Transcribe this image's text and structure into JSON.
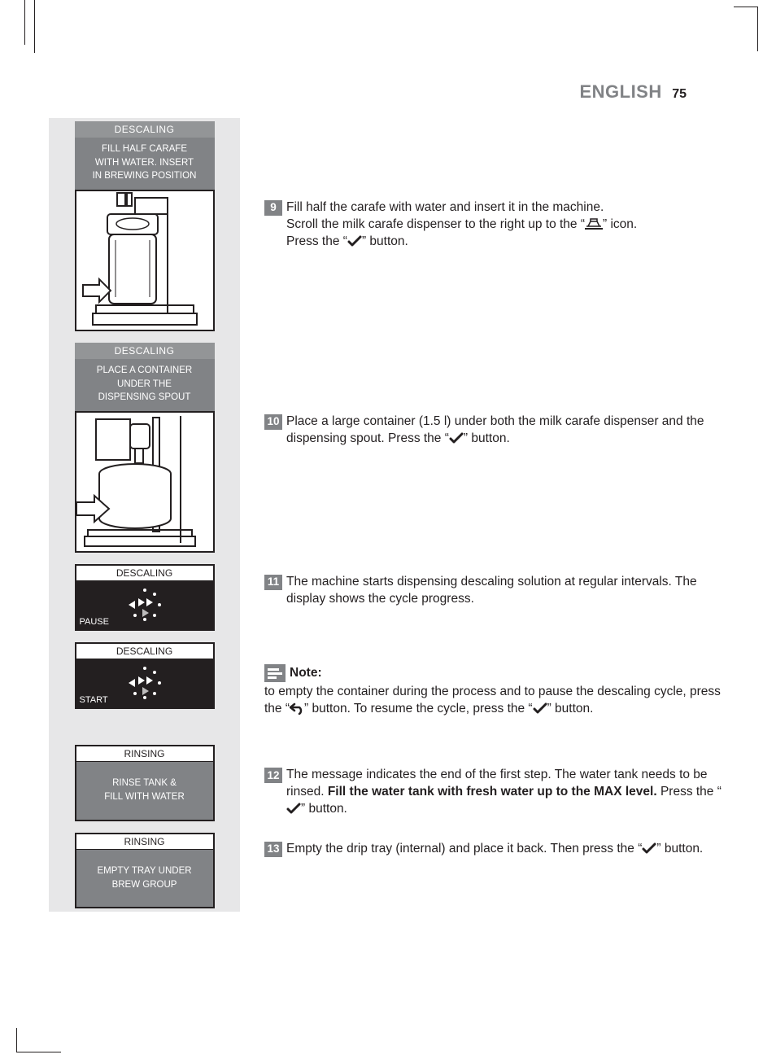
{
  "header": {
    "language": "ENGLISH",
    "page": "75"
  },
  "sidebar": {
    "panel1": {
      "title": "DESCALING",
      "body_l1": "FILL HALF CARAFE",
      "body_l2": "WITH WATER. INSERT",
      "body_l3": "IN BREWING POSITION"
    },
    "panel2": {
      "title": "DESCALING",
      "body_l1": "PLACE A CONTAINER",
      "body_l2": "UNDER THE",
      "body_l3": "DISPENSING SPOUT"
    },
    "disp1": {
      "title": "DESCALING",
      "label": "PAUSE"
    },
    "disp2": {
      "title": "DESCALING",
      "label": "START"
    },
    "rinse1": {
      "title": "RINSING",
      "body_l1": "RINSE TANK &",
      "body_l2": "FILL WITH WATER"
    },
    "rinse2": {
      "title": "RINSING",
      "body_l1": "EMPTY TRAY UNDER",
      "body_l2": "BREW GROUP"
    }
  },
  "steps": {
    "s9": {
      "num": "9",
      "l1": "Fill half the carafe with water and insert it in the machine.",
      "l2a": "Scroll the milk carafe dispenser to the right up to the “",
      "l2b": "” icon.",
      "l3a": "Press the “",
      "l3b": "” button."
    },
    "s10": {
      "num": "10",
      "l1a": "Place a large container (1.5 l) under both the milk carafe dispenser and the dispensing spout. Press the “",
      "l1b": "” button."
    },
    "s11": {
      "num": "11",
      "text": "The machine starts dispensing descaling solution at regular intervals. The display shows the cycle progress."
    },
    "note": {
      "label": "Note:",
      "t1": "to empty the container during the process and to pause the descaling cycle, press the “",
      "t2": "” button. To resume the cycle, press the “",
      "t3": "” button."
    },
    "s12": {
      "num": "12",
      "t1": "The message indicates the end of the first step. The water tank needs to be rinsed. ",
      "bold": "Fill the water tank with fresh water up to the MAX level.",
      "t2a": " Press the “",
      "t2b": "” button."
    },
    "s13": {
      "num": "13",
      "t1a": "Empty the drip tray (internal) and place it back. Then press the “",
      "t1b": "” button."
    }
  }
}
